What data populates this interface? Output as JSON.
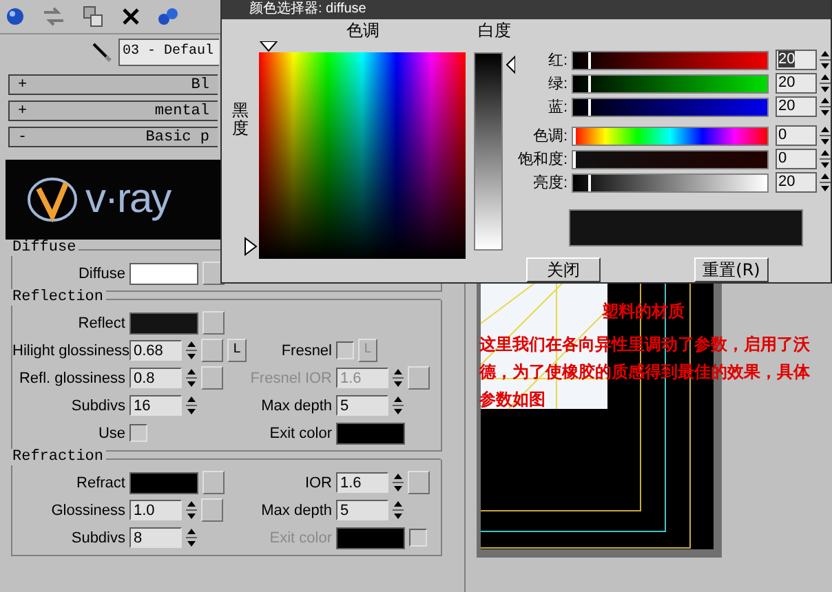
{
  "material_editor": {
    "material_name": "03 - Defaul",
    "rollouts": [
      {
        "sign": "+",
        "title": "Bl"
      },
      {
        "sign": "+",
        "title": "mental"
      },
      {
        "sign": "-",
        "title": "Basic p"
      }
    ],
    "logo_text": "v·ray",
    "groups": [
      {
        "title": "Diffuse",
        "rows": [
          {
            "left": {
              "kind": "color",
              "label": "Diffuse",
              "color": "#ffffff",
              "map": true
            }
          }
        ]
      },
      {
        "title": "Reflection",
        "rows": [
          {
            "left": {
              "kind": "color",
              "label": "Reflect",
              "color": "#141414",
              "map": true
            }
          },
          {
            "left": {
              "kind": "spinner",
              "label": "Hilight glossiness",
              "value": "0.68",
              "map": true,
              "lock": {
                "label": "L",
                "disabled": false
              }
            },
            "right": {
              "kind": "checkbox",
              "label": "Fresnel",
              "checked": false,
              "lock": {
                "label": "L",
                "disabled": true
              }
            }
          },
          {
            "left": {
              "kind": "spinner",
              "label": "Refl. glossiness",
              "value": "0.8",
              "map": true
            },
            "right": {
              "kind": "spinner",
              "label": "Fresnel IOR",
              "value": "1.6",
              "disabled": true,
              "map": true
            }
          },
          {
            "left": {
              "kind": "spinner",
              "label": "Subdivs",
              "value": "16"
            },
            "right": {
              "kind": "spinner",
              "label": "Max depth",
              "value": "5"
            }
          },
          {
            "left": {
              "kind": "checkbox",
              "label": "Use",
              "checked": false
            },
            "right": {
              "kind": "color",
              "label": "Exit color",
              "color": "#000000"
            }
          }
        ]
      },
      {
        "title": "Refraction",
        "rows": [
          {
            "left": {
              "kind": "color",
              "label": "Refract",
              "color": "#000000",
              "map": true
            },
            "right": {
              "kind": "spinner",
              "label": "IOR",
              "value": "1.6",
              "map": true
            }
          },
          {
            "left": {
              "kind": "spinner",
              "label": "Glossiness",
              "value": "1.0",
              "map": true
            },
            "right": {
              "kind": "spinner",
              "label": "Max depth",
              "value": "5"
            }
          },
          {
            "left": {
              "kind": "spinner",
              "label": "Subdivs",
              "value": "8"
            },
            "right": {
              "kind": "color",
              "label": "Exit color",
              "color": "#000000",
              "disabled": true,
              "checkbox": {
                "checked": false
              }
            }
          }
        ]
      }
    ]
  },
  "color_dialog": {
    "title": "颜色选择器: diffuse",
    "hue_label": "色调",
    "blackness_label": "黑度",
    "whiteness_label": "白度",
    "channels": [
      {
        "kind": "red",
        "label": "红:",
        "value": "20",
        "level": 0.08,
        "selected": true
      },
      {
        "kind": "green",
        "label": "绿:",
        "value": "20",
        "level": 0.08,
        "selected": false
      },
      {
        "kind": "blue",
        "label": "蓝:",
        "value": "20",
        "level": 0.08,
        "selected": false
      },
      {
        "kind": "hue",
        "label": "色调:",
        "value": "0",
        "level": 0,
        "selected": false
      },
      {
        "kind": "saturation",
        "label": "饱和度:",
        "value": "0",
        "level": 0,
        "selected": false
      },
      {
        "kind": "brightness",
        "label": "亮度:",
        "value": "20",
        "level": 0.08,
        "selected": false
      }
    ],
    "buttons": [
      {
        "label": "关闭"
      },
      {
        "label": "重置(R)"
      }
    ]
  },
  "note": {
    "title": "塑料的材质",
    "body": "这里我们在各向异性里调动了参数，启用了沃德，为了使橡胶的质感得到最佳的效果，具体参数如图"
  }
}
